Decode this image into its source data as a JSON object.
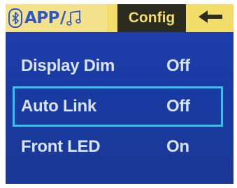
{
  "tabs": {
    "app": {
      "bluetooth_icon": "bluetooth-icon",
      "text": "APP",
      "separator": "/",
      "music_icon": "music-note-icon"
    },
    "config": {
      "label": "Config"
    },
    "back": {
      "icon": "back-arrow-icon"
    }
  },
  "menu": {
    "items": [
      {
        "label": "Display Dim",
        "value": "Off",
        "selected": false
      },
      {
        "label": "Auto Link",
        "value": "Off",
        "selected": true
      },
      {
        "label": "Front LED",
        "value": "On",
        "selected": false
      }
    ]
  },
  "colors": {
    "screen_bg": "#1e3fae",
    "tabbar_bg": "#f2dc6a",
    "active_tab_bg": "#2b2b20",
    "active_tab_text": "#f6de6c",
    "menu_text": "#d8e3ff",
    "selection_border": "#35c3ee",
    "app_tab_text": "#2e57c6"
  }
}
